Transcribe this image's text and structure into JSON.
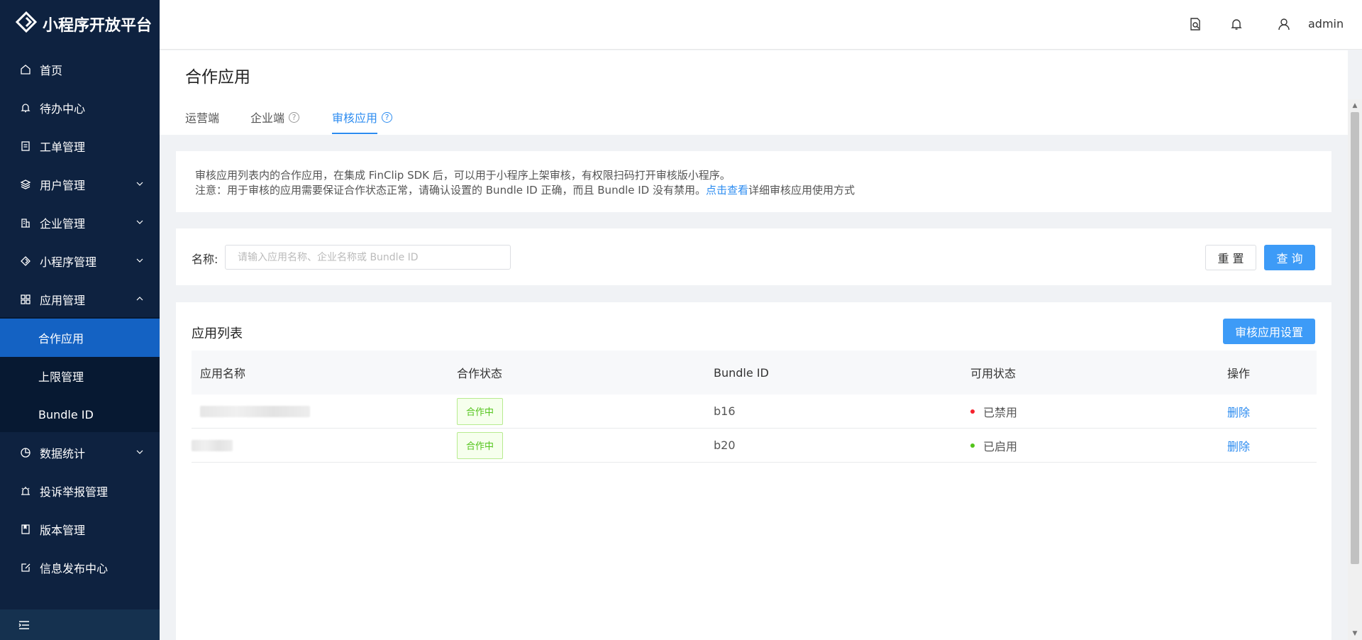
{
  "brand": {
    "title": "小程序开放平台"
  },
  "sidebar": {
    "items": [
      {
        "label": "首页",
        "icon": "home-icon"
      },
      {
        "label": "待办中心",
        "icon": "bell-icon"
      },
      {
        "label": "工单管理",
        "icon": "clipboard-icon"
      },
      {
        "label": "用户管理",
        "icon": "layers-icon"
      },
      {
        "label": "企业管理",
        "icon": "building-icon"
      },
      {
        "label": "小程序管理",
        "icon": "diamond-icon"
      },
      {
        "label": "应用管理",
        "icon": "grid-icon"
      },
      {
        "label": "数据统计",
        "icon": "pie-icon"
      },
      {
        "label": "投诉举报管理",
        "icon": "alarm-icon"
      },
      {
        "label": "版本管理",
        "icon": "bookmark-icon"
      },
      {
        "label": "信息发布中心",
        "icon": "edit-icon"
      }
    ],
    "subitems": [
      {
        "label": "合作应用",
        "active": true
      },
      {
        "label": "上限管理",
        "active": false
      },
      {
        "label": "Bundle ID",
        "active": false
      }
    ]
  },
  "header": {
    "username": "admin"
  },
  "page": {
    "title": "合作应用",
    "tabs": [
      {
        "label": "运营端"
      },
      {
        "label": "企业端"
      },
      {
        "label": "审核应用"
      }
    ],
    "help_icon": "?"
  },
  "notice": {
    "line1": "审核应用列表内的合作应用，在集成 FinClip SDK 后，可以用于小程序上架审核，有权限扫码打开审核版小程序。",
    "line2_prefix": "注意：用于审核的应用需要保证合作状态正常，请确认设置的 Bundle ID 正确，而且 Bundle ID 没有禁用。",
    "line2_link": "点击查看",
    "line2_suffix": "详细审核应用使用方式"
  },
  "filter": {
    "label": "名称:",
    "placeholder": "请输入应用名称、企业名称或 Bundle ID",
    "value": "",
    "reset_label": "重 置",
    "query_label": "查 询"
  },
  "list": {
    "title": "应用列表",
    "settings_button": "审核应用设置",
    "columns": [
      "应用名称",
      "合作状态",
      "Bundle ID",
      "可用状态",
      "操作"
    ],
    "rows": [
      {
        "name": "",
        "coop_status": "合作中",
        "bundle_id": "b16",
        "avail_status": "已禁用",
        "avail_color": "#f5222d",
        "action": "删除"
      },
      {
        "name": "",
        "coop_status": "合作中",
        "bundle_id": "b20",
        "avail_status": "已启用",
        "avail_color": "#52c41a",
        "action": "删除"
      }
    ]
  },
  "colors": {
    "sidebar_bg": "#0e2240",
    "active_menu": "#1462c3",
    "primary": "#3d9bf7",
    "link": "#2d8cf0"
  }
}
